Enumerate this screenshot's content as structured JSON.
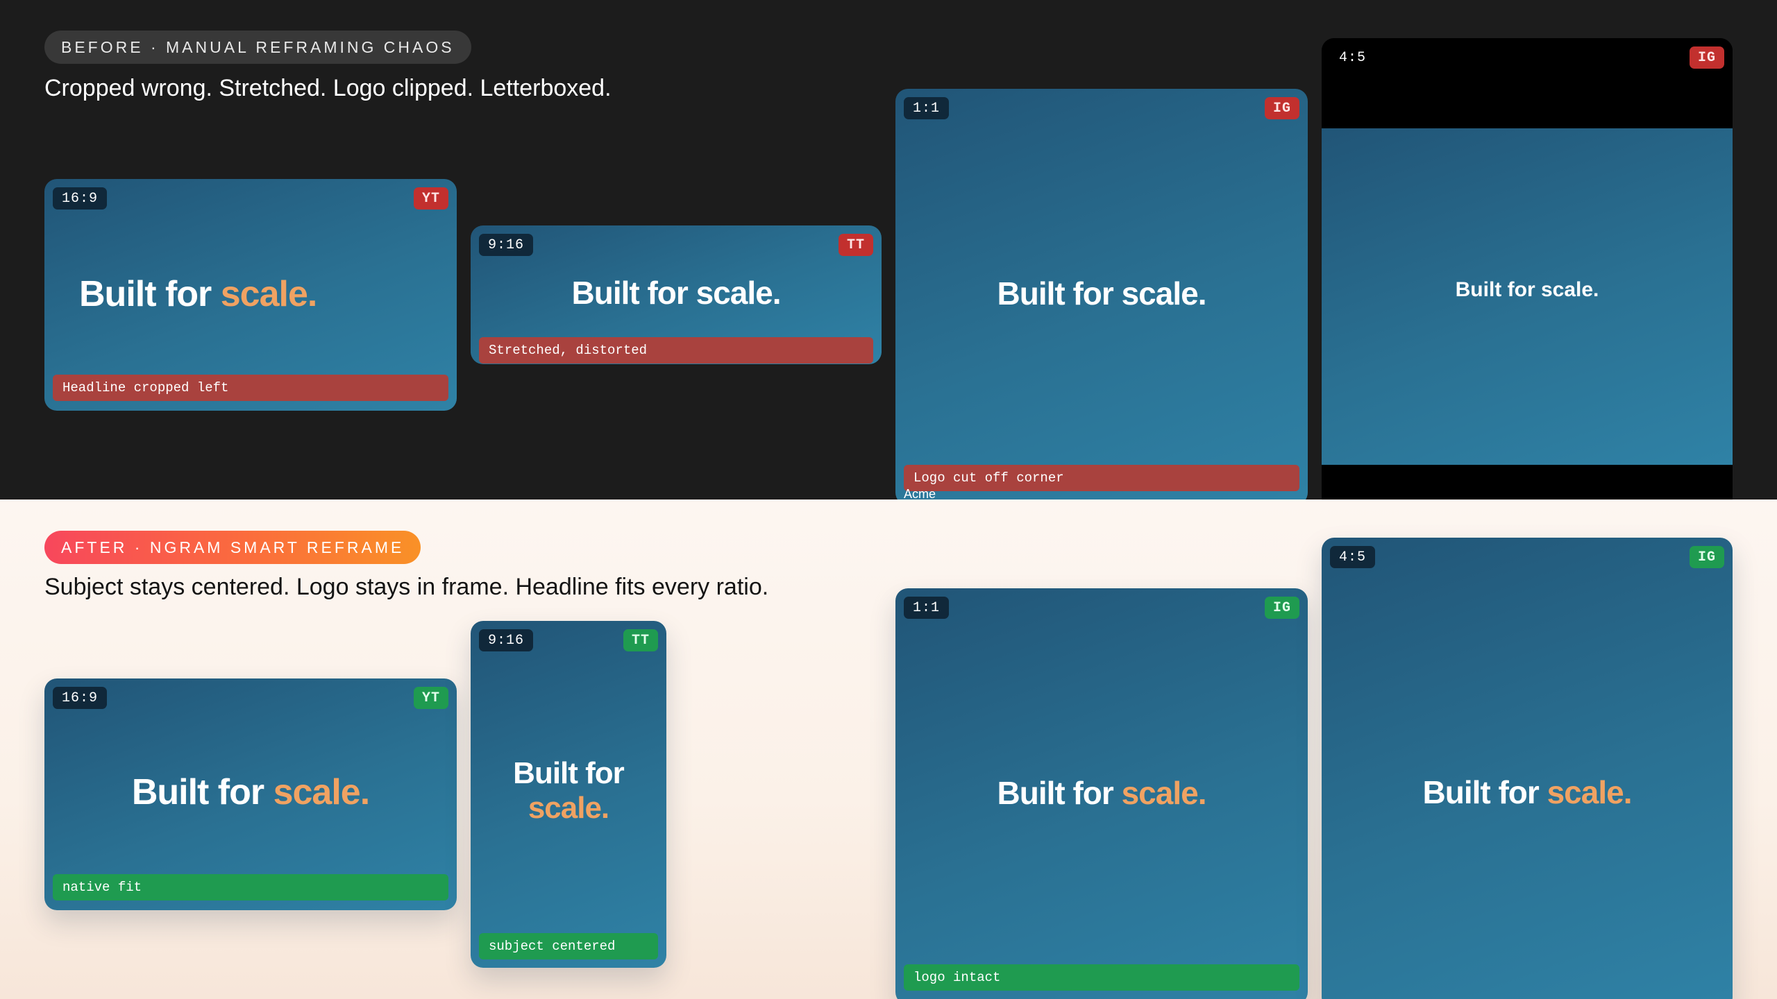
{
  "before": {
    "pill": "BEFORE · MANUAL REFRAMING CHAOS",
    "subtitle": "Cropped wrong. Stretched. Logo clipped. Letterboxed.",
    "cards": [
      {
        "ratio": "16:9",
        "platform": "YT",
        "headline_pre": "Built for ",
        "headline_accent": "scale.",
        "note": "Headline cropped left"
      },
      {
        "ratio": "9:16",
        "platform": "TT",
        "headline": "Built for scale.",
        "note": "Stretched, distorted"
      },
      {
        "ratio": "1:1",
        "platform": "IG",
        "headline": "Built for scale.",
        "note": "Logo cut off corner",
        "logo": "Acme"
      },
      {
        "ratio": "4:5",
        "platform": "IG",
        "headline": "Built for scale."
      }
    ]
  },
  "after": {
    "pill": "AFTER · NGRAM SMART REFRAME",
    "subtitle": "Subject stays centered. Logo stays in frame. Headline fits every ratio.",
    "cards": [
      {
        "ratio": "16:9",
        "platform": "YT",
        "headline_pre": "Built for ",
        "headline_accent": "scale.",
        "note": "native fit"
      },
      {
        "ratio": "9:16",
        "platform": "TT",
        "headline_pre": "Built for",
        "headline_accent": "scale.",
        "note": "subject centered"
      },
      {
        "ratio": "1:1",
        "platform": "IG",
        "headline_pre": "Built for ",
        "headline_accent": "scale.",
        "note": "logo intact"
      },
      {
        "ratio": "4:5",
        "platform": "IG",
        "headline_pre": "Built for ",
        "headline_accent": "scale."
      }
    ]
  },
  "colors": {
    "before_bg": "#1c1c1c",
    "card_gradient_start": "#215577",
    "card_gradient_end": "#2f82a6",
    "accent": "#f0a262",
    "bad": "#c2302e",
    "good": "#1f9b50"
  }
}
